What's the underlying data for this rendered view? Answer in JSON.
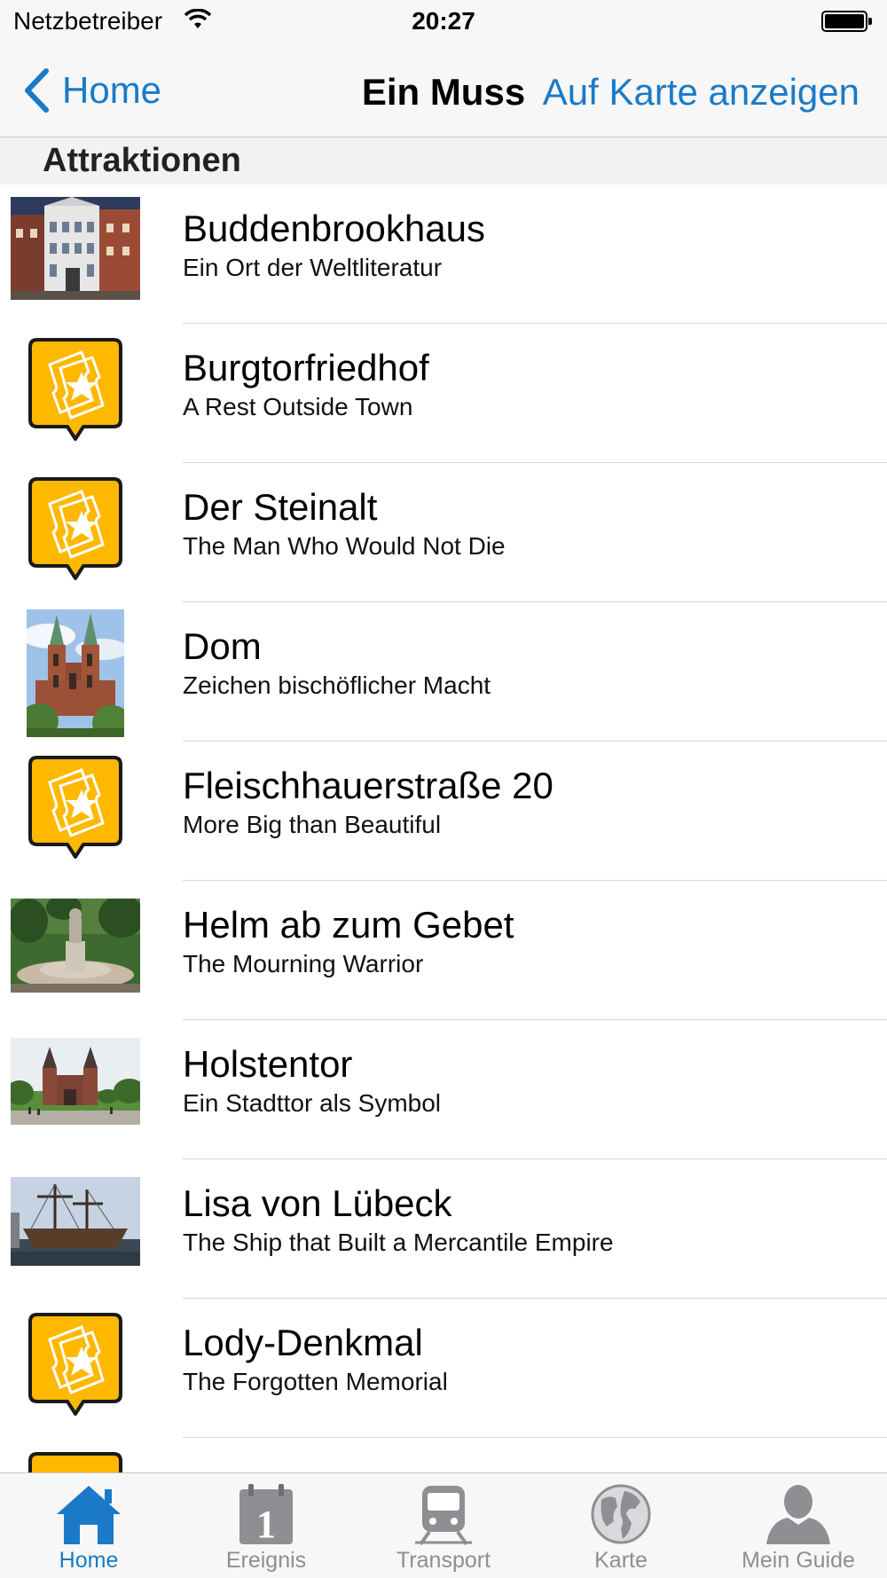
{
  "status_bar": {
    "carrier": "Netzbetreiber",
    "time": "20:27"
  },
  "nav": {
    "back_label": "Home",
    "title": "Ein Muss",
    "right_button": "Auf Karte anzeigen"
  },
  "section": {
    "title": "Attraktionen"
  },
  "items": [
    {
      "title": "Buddenbrookhaus",
      "subtitle": "Ein Ort der Weltliteratur",
      "thumbnail": "photo-buddenbrookhaus"
    },
    {
      "title": "Burgtorfriedhof",
      "subtitle": "A Rest Outside Town",
      "thumbnail": "ticket-star-icon"
    },
    {
      "title": "Der Steinalt",
      "subtitle": "The Man Who Would Not Die",
      "thumbnail": "ticket-star-icon"
    },
    {
      "title": "Dom",
      "subtitle": "Zeichen bischöflicher Macht",
      "thumbnail": "photo-dom"
    },
    {
      "title": "Fleischhauerstraße 20",
      "subtitle": "More Big than Beautiful",
      "thumbnail": "ticket-star-icon"
    },
    {
      "title": "Helm ab zum Gebet",
      "subtitle": "The Mourning Warrior",
      "thumbnail": "photo-statue"
    },
    {
      "title": "Holstentor",
      "subtitle": "Ein Stadttor als Symbol",
      "thumbnail": "photo-holstentor"
    },
    {
      "title": "Lisa von Lübeck",
      "subtitle": "The Ship that Built a Mercantile Empire",
      "thumbnail": "photo-ship"
    },
    {
      "title": "Lody-Denkmal",
      "subtitle": "The Forgotten Memorial",
      "thumbnail": "ticket-star-icon"
    }
  ],
  "tabs": [
    {
      "label": "Home",
      "icon": "house-icon",
      "active": true
    },
    {
      "label": "Ereignis",
      "icon": "calendar-icon",
      "active": false
    },
    {
      "label": "Transport",
      "icon": "train-icon",
      "active": false
    },
    {
      "label": "Karte",
      "icon": "globe-icon",
      "active": false
    },
    {
      "label": "Mein Guide",
      "icon": "person-icon",
      "active": false
    }
  ],
  "colors": {
    "accent": "#1a7ac8",
    "ticket_yellow": "#ffb800",
    "inactive_tab": "#8e8e93"
  }
}
